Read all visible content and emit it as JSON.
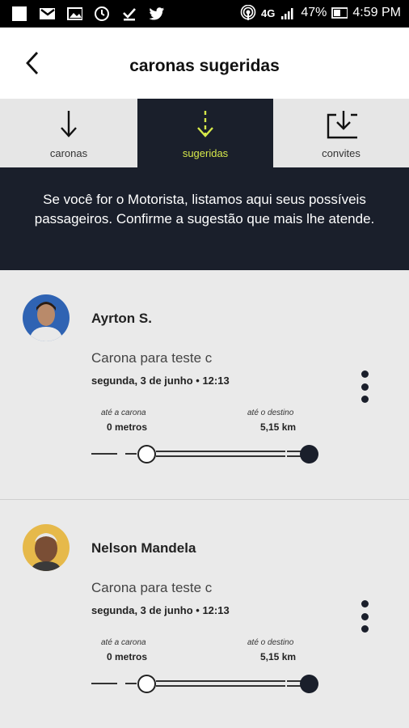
{
  "status_bar": {
    "network": "4G",
    "battery": "47%",
    "time": "4:59 PM"
  },
  "header": {
    "title": "caronas sugeridas"
  },
  "tabs": [
    {
      "label": "caronas",
      "active": false
    },
    {
      "label": "sugeridas",
      "active": true
    },
    {
      "label": "convites",
      "active": false
    }
  ],
  "banner": {
    "text": "Se você for o Motorista, listamos aqui seus possíveis passageiros. Confirme a sugestão que mais lhe atende."
  },
  "rides": [
    {
      "name": "Ayrton S.",
      "description": "Carona para teste c",
      "datetime": "segunda, 3 de junho • 12:13",
      "to_pickup_label": "até a carona",
      "to_pickup_value": "0 metros",
      "to_dest_label": "até o destino",
      "to_dest_value": "5,15 km"
    },
    {
      "name": "Nelson Mandela",
      "description": "Carona para teste c",
      "datetime": "segunda, 3 de junho • 12:13",
      "to_pickup_label": "até a carona",
      "to_pickup_value": "0 metros",
      "to_dest_label": "até o destino",
      "to_dest_value": "5,15 km"
    }
  ],
  "colors": {
    "dark": "#1a1f2b",
    "accent": "#d6e84a",
    "background": "#eaeaea"
  }
}
